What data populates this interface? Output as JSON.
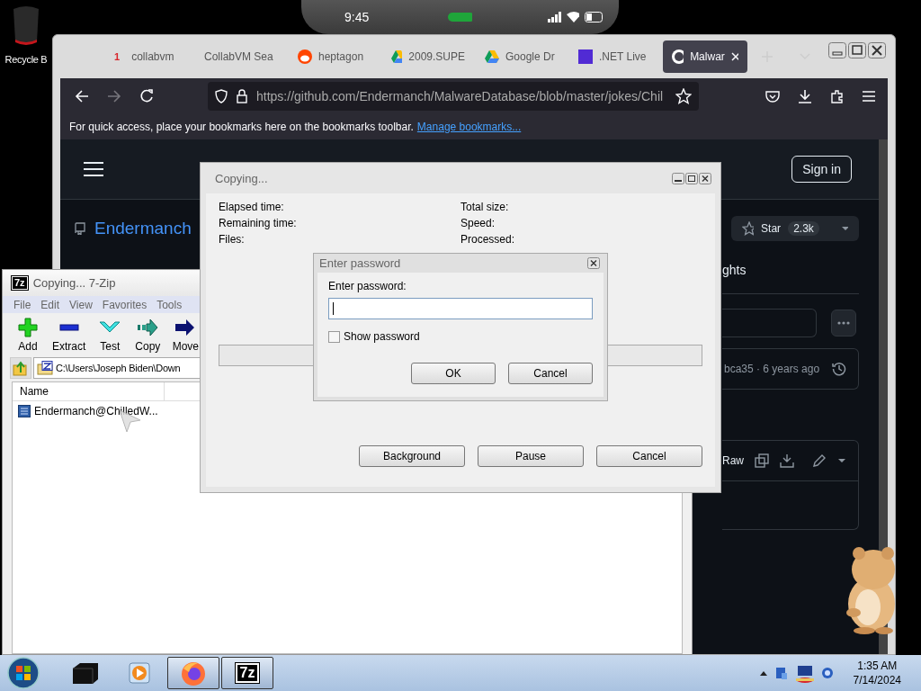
{
  "desktop": {
    "icons": [
      {
        "label": "Recycle B"
      }
    ]
  },
  "phone_status": {
    "time": "9:45"
  },
  "browser": {
    "tabs": [
      {
        "kind": "counter",
        "badge": "1",
        "label": "collabvm",
        "selected": false
      },
      {
        "kind": "plain",
        "label": "CollabVM Sea",
        "selected": false
      },
      {
        "kind": "reddit",
        "label": "heptagon",
        "selected": false
      },
      {
        "kind": "drive",
        "label": "2009.SUPE",
        "selected": false
      },
      {
        "kind": "drive",
        "label": "Google Dr",
        "selected": false
      },
      {
        "kind": "dotnet",
        "label": ".NET Live",
        "selected": false
      },
      {
        "kind": "github",
        "label": "Malwar",
        "selected": true
      }
    ],
    "url": "https://github.com/Endermanch/MalwareDatabase/blob/master/jokes/Chil",
    "bookmarks_hint": "For quick access, place your bookmarks here on the bookmarks toolbar.",
    "bookmarks_link": "Manage bookmarks...",
    "page": {
      "sign_in": "Sign in",
      "repo_owner": "Endermanch",
      "star_label": "Star",
      "star_count": "2.3k",
      "tab_fragment": "ghts",
      "commit_text": "bca35 · 6 years ago",
      "raw_label": "Raw"
    }
  },
  "copy_dialog": {
    "title": "Copying...",
    "left_fields": [
      "Elapsed time:",
      "Remaining time:",
      "Files:"
    ],
    "right_fields": [
      "Total size:",
      "Speed:",
      "Processed:"
    ],
    "progress": {
      "level": 0
    },
    "buttons": [
      "Background",
      "Pause",
      "Cancel"
    ]
  },
  "password_dialog": {
    "title": "Enter password",
    "prompt": "Enter password:",
    "show_password": {
      "label": "Show password",
      "checked": false
    },
    "buttons": [
      "OK",
      "Cancel"
    ]
  },
  "sevenzip": {
    "title": "Copying... 7-Zip",
    "icon_text": "7z",
    "menu": [
      "File",
      "Edit",
      "View",
      "Favorites",
      "Tools"
    ],
    "toolbar": [
      {
        "kind": "add",
        "label": "Add"
      },
      {
        "kind": "extract",
        "label": "Extract"
      },
      {
        "kind": "test",
        "label": "Test"
      },
      {
        "kind": "copy",
        "label": "Copy"
      },
      {
        "kind": "move",
        "label": "Move"
      }
    ],
    "path": "C:\\Users\\Joseph Biden\\Down",
    "columns": [
      "Name"
    ],
    "rows": [
      {
        "name": "Endermanch@ChilledW...",
        "selected": false
      }
    ]
  },
  "taskbar": {
    "items": [
      {
        "kind": "box",
        "running": false
      },
      {
        "kind": "media",
        "running": false
      },
      {
        "kind": "firefox",
        "running": true
      },
      {
        "kind": "sevenzip",
        "label": "7z",
        "running": true
      }
    ],
    "clock_time": "1:35 AM",
    "clock_date": "7/14/2024"
  }
}
